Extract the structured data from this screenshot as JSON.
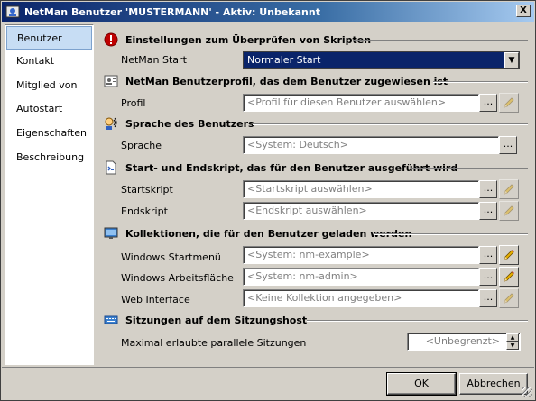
{
  "window": {
    "title": "NetMan Benutzer 'MUSTERMANN' - Aktiv: Unbekannt",
    "close_label": "X"
  },
  "nav": {
    "items": [
      "Benutzer",
      "Kontakt",
      "Mitglied von",
      "Autostart",
      "Eigenschaften",
      "Beschreibung"
    ],
    "selected": "Benutzer"
  },
  "sections": {
    "scripts": {
      "title": "Einstellungen zum Überprüfen von Skripten",
      "netman_start_label": "NetMan Start",
      "netman_start_value": "Normaler Start"
    },
    "profile": {
      "title": "NetMan Benutzerprofil, das dem Benutzer zugewiesen ist",
      "label": "Profil",
      "placeholder": "<Profil für diesen Benutzer auswählen>"
    },
    "language": {
      "title": "Sprache des Benutzers",
      "label": "Sprache",
      "value": "<System: Deutsch>"
    },
    "startend": {
      "title": "Start- und Endskript, das für den Benutzer ausgeführt wird",
      "start_label": "Startskript",
      "start_value": "<Startskript auswählen>",
      "end_label": "Endskript",
      "end_value": "<Endskript auswählen>"
    },
    "collections": {
      "title": "Kollektionen, die für den Benutzer geladen werden",
      "startmenu_label": "Windows Startmenü",
      "startmenu_value": "<System: nm-example>",
      "desktop_label": "Windows Arbeitsfläche",
      "desktop_value": "<System: nm-admin>",
      "web_label": "Web Interface",
      "web_value": "<Keine Kollektion angegeben>"
    },
    "sessions": {
      "title": "Sitzungen auf dem Sitzungshost",
      "max_label": "Maximal erlaubte parallele Sitzungen",
      "max_value": "<Unbegrenzt>"
    }
  },
  "buttons": {
    "browse": "...",
    "ok": "OK",
    "cancel": "Abbrechen"
  },
  "colors": {
    "title_bar": "#0a246a",
    "nav_selected": "#c7ddf4",
    "combo_selected": "#0a246a"
  }
}
